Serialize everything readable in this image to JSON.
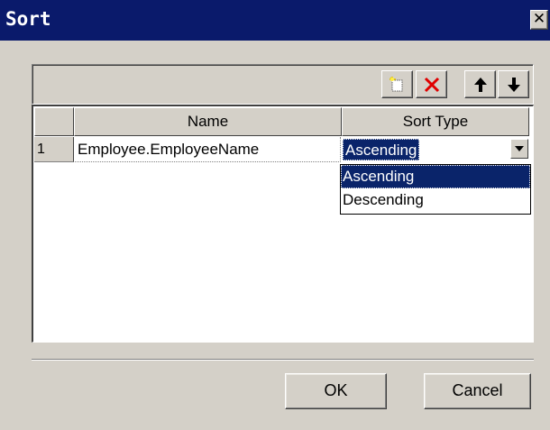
{
  "window": {
    "title": "Sort",
    "close_glyph": "✕"
  },
  "toolbar": {
    "buttons": [
      {
        "icon": "new-item-icon"
      },
      {
        "icon": "delete-icon"
      },
      {
        "icon": "arrow-up-icon"
      },
      {
        "icon": "arrow-down-icon"
      }
    ]
  },
  "grid": {
    "columns": [
      "Name",
      "Sort Type"
    ],
    "rows": [
      {
        "index": "1",
        "name": "Employee.EmployeeName",
        "sort_type": "Ascending"
      }
    ]
  },
  "dropdown": {
    "options": [
      "Ascending",
      "Descending"
    ],
    "selected": "Ascending"
  },
  "buttons": {
    "ok": "OK",
    "cancel": "Cancel"
  },
  "colors": {
    "titlebar": "#0a1a6b",
    "selection": "#0a246a",
    "face": "#d4d0c8",
    "delete": "#e00000"
  }
}
